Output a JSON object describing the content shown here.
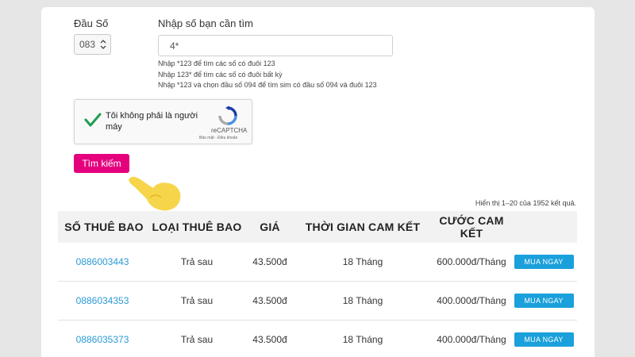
{
  "form": {
    "prefix_label": "Đầu Số",
    "prefix_value": "083",
    "search_label": "Nhập số bạn cần tìm",
    "search_value": "4*",
    "hints": [
      "Nhập *123 để tìm các số có đuôi 123",
      "Nhập 123* để tìm các số có đuôi bất kỳ",
      "Nhập *123 và chọn đầu số 094 để tìm sim có đầu số 094 và đuôi 123"
    ],
    "captcha_text": "Tôi không phải là người máy",
    "captcha_brand": "reCAPTCHA",
    "captcha_terms": "Bảo mật - Điều khoản",
    "search_button": "Tìm kiếm"
  },
  "results": {
    "count_text": "Hiển thị 1–20 của 1952 kết quả.",
    "columns": [
      "SỐ THUÊ BAO",
      "LOẠI THUÊ BAO",
      "GIÁ",
      "THỜI GIAN CAM KẾT",
      "CƯỚC CAM KẾT"
    ],
    "rows": [
      {
        "number": "0886003443",
        "type": "Trả sau",
        "price": "43.500đ",
        "term": "18 Tháng",
        "fee": "600.000đ/Tháng",
        "action": "MUA NGAY"
      },
      {
        "number": "0886034353",
        "type": "Trả sau",
        "price": "43.500đ",
        "term": "18 Tháng",
        "fee": "400.000đ/Tháng",
        "action": "MUA NGAY"
      },
      {
        "number": "0886035373",
        "type": "Trả sau",
        "price": "43.500đ",
        "term": "18 Tháng",
        "fee": "400.000đ/Tháng",
        "action": "MUA NGAY"
      }
    ]
  },
  "colors": {
    "search_button": "#e5007e",
    "buy_button": "#1aa0db",
    "link": "#2a9bd6",
    "captcha_check": "#1e9e4f",
    "pointer_hand": "#f7d54a"
  },
  "icons": [
    "chevron-updown-icon",
    "checkmark-icon",
    "recaptcha-logo-icon",
    "pointing-hand-icon"
  ]
}
